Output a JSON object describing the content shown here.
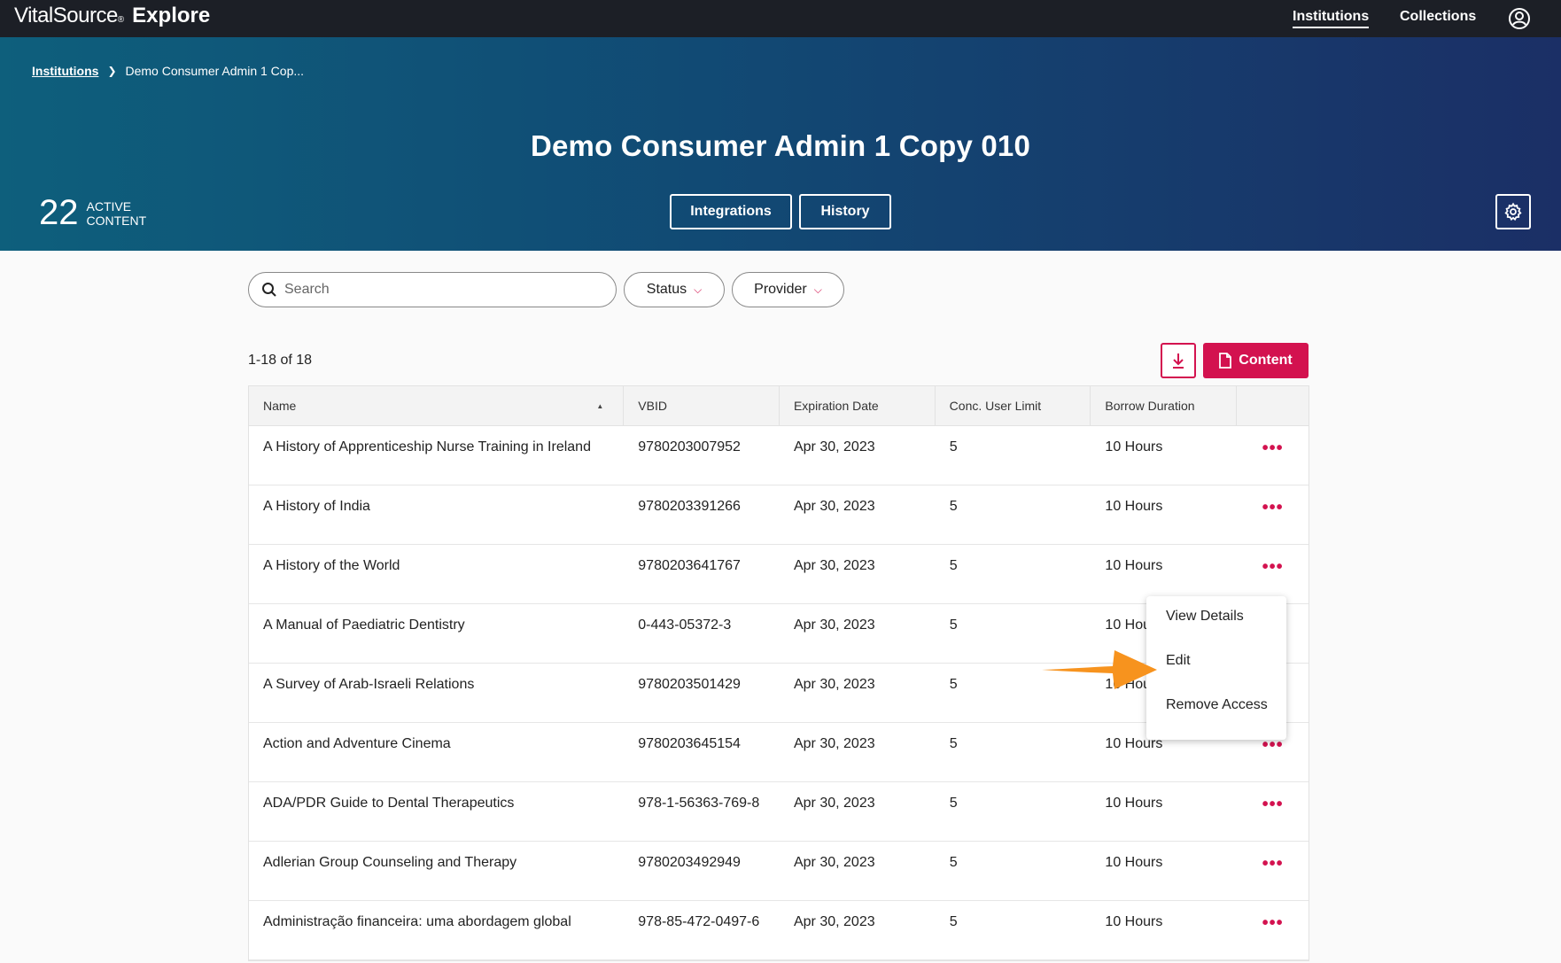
{
  "topnav": {
    "brand_part1": "VitalSource",
    "brand_mark": "®",
    "brand_part2": "Explore",
    "links": [
      "Institutions",
      "Collections"
    ]
  },
  "hero": {
    "breadcrumb_root": "Institutions",
    "breadcrumb_current": "Demo Consumer Admin 1 Cop...",
    "title": "Demo Consumer Admin 1 Copy 010",
    "count": "22",
    "count_label_1": "ACTIVE",
    "count_label_2": "CONTENT",
    "buttons": [
      "Integrations",
      "History"
    ]
  },
  "filters": {
    "search_placeholder": "Search",
    "status_label": "Status",
    "provider_label": "Provider"
  },
  "toolbar": {
    "results": "1-18 of 18",
    "content_label": "Content"
  },
  "table": {
    "columns": [
      "Name",
      "VBID",
      "Expiration Date",
      "Conc. User Limit",
      "Borrow Duration"
    ],
    "rows": [
      {
        "name": "A History of Apprenticeship Nurse Training in Ireland",
        "vbid": "9780203007952",
        "exp": "Apr 30, 2023",
        "limit": "5",
        "borrow": "10 Hours"
      },
      {
        "name": "A History of India",
        "vbid": "9780203391266",
        "exp": "Apr 30, 2023",
        "limit": "5",
        "borrow": "10 Hours"
      },
      {
        "name": "A History of the World",
        "vbid": "9780203641767",
        "exp": "Apr 30, 2023",
        "limit": "5",
        "borrow": "10 Hours"
      },
      {
        "name": "A Manual of Paediatric Dentistry",
        "vbid": "0-443-05372-3",
        "exp": "Apr 30, 2023",
        "limit": "5",
        "borrow": "10 Hours"
      },
      {
        "name": "A Survey of Arab-Israeli Relations",
        "vbid": "9780203501429",
        "exp": "Apr 30, 2023",
        "limit": "5",
        "borrow": "10 Hours"
      },
      {
        "name": "Action and Adventure Cinema",
        "vbid": "9780203645154",
        "exp": "Apr 30, 2023",
        "limit": "5",
        "borrow": "10 Hours"
      },
      {
        "name": "ADA/PDR Guide to Dental Therapeutics",
        "vbid": "978-1-56363-769-8",
        "exp": "Apr 30, 2023",
        "limit": "5",
        "borrow": "10 Hours"
      },
      {
        "name": "Adlerian Group Counseling and Therapy",
        "vbid": "9780203492949",
        "exp": "Apr 30, 2023",
        "limit": "5",
        "borrow": "10 Hours"
      },
      {
        "name": "Administração financeira: uma abordagem global",
        "vbid": "978-85-472-0497-6",
        "exp": "Apr 30, 2023",
        "limit": "5",
        "borrow": "10 Hours"
      }
    ],
    "more_glyph": "•••"
  },
  "menu": {
    "items": [
      "View Details",
      "Edit",
      "Remove Access"
    ]
  },
  "colors": {
    "accent": "#d3124f",
    "topnav": "#1c1f26",
    "arrow": "#f7931e"
  }
}
